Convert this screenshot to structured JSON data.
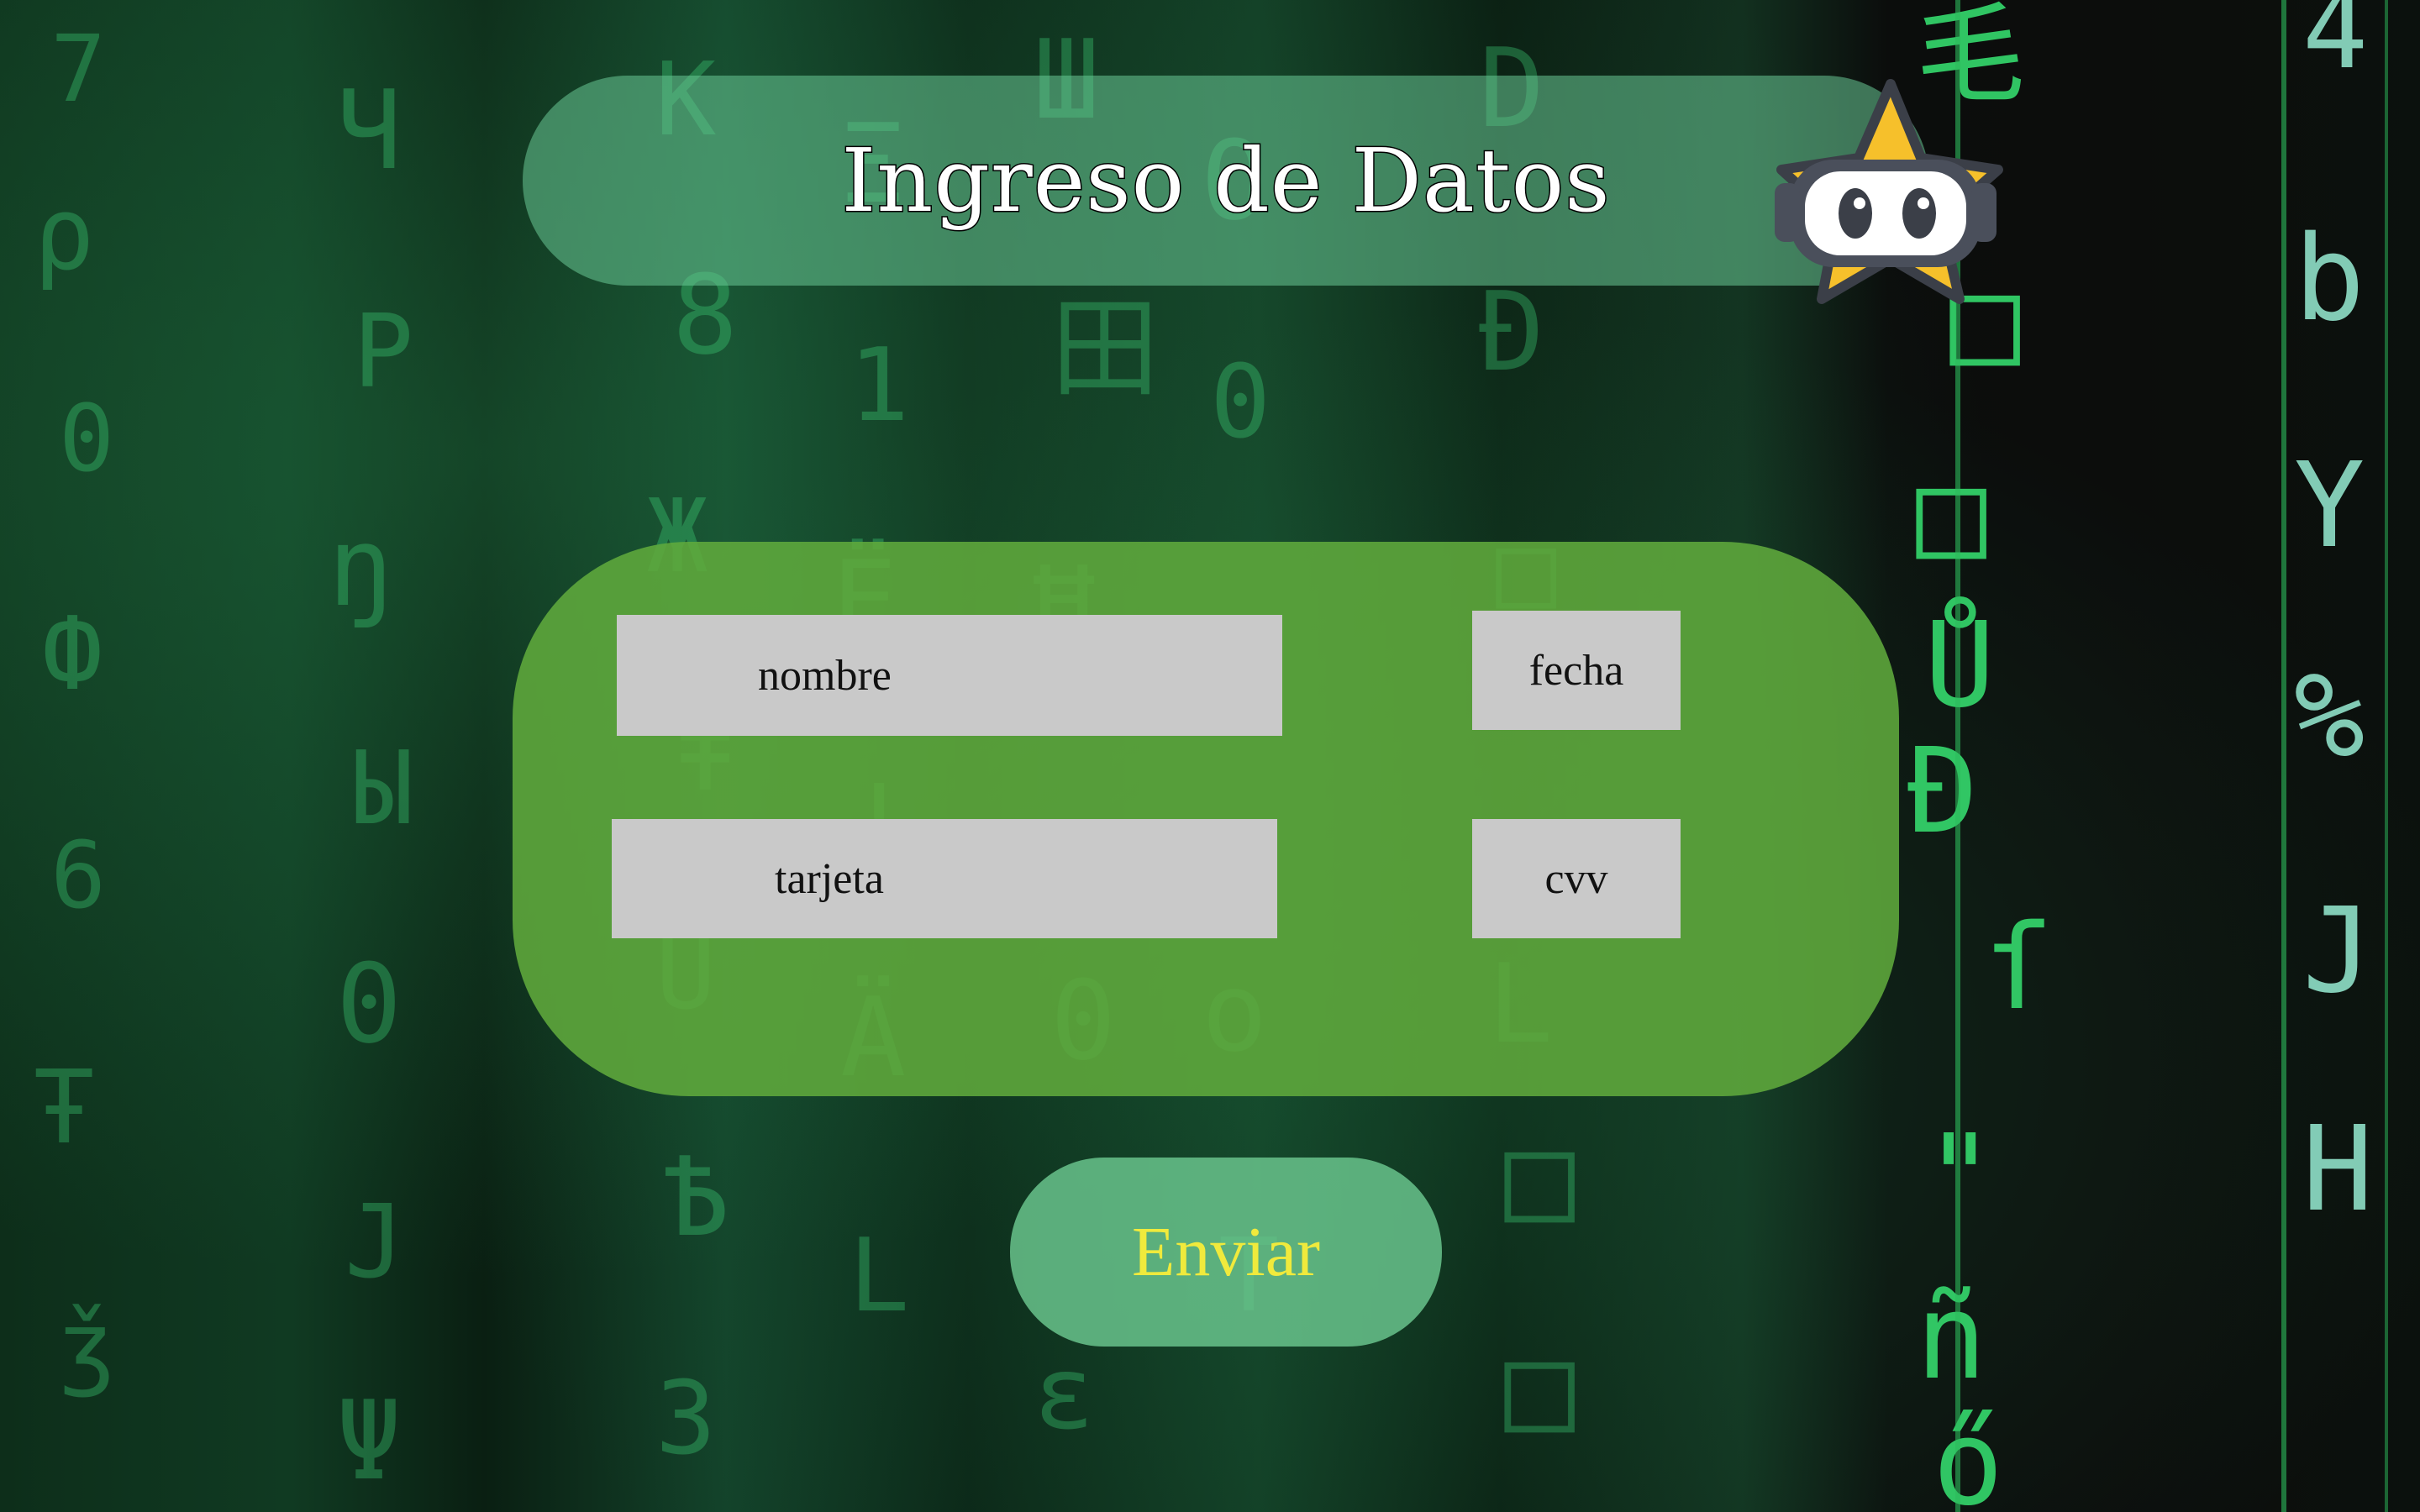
{
  "header": {
    "title": "Ingreso de Datos"
  },
  "form": {
    "fields": [
      {
        "id": "nombre",
        "label": "nombre"
      },
      {
        "id": "fecha",
        "label": "fecha"
      },
      {
        "id": "tarjeta",
        "label": "tarjeta"
      },
      {
        "id": "cvv",
        "label": "cvv"
      }
    ]
  },
  "actions": {
    "submit_label": "Enviar"
  },
  "background": {
    "icon": "matrix-code-rain"
  },
  "mascot": {
    "icon": "star-robot-mascot-icon"
  },
  "colors": {
    "banner": "#69c896",
    "panel": "#60aa3c",
    "field": "#c9c9c9",
    "submit_text": "#f0ea3c",
    "rain": "#2fbf5f"
  }
}
